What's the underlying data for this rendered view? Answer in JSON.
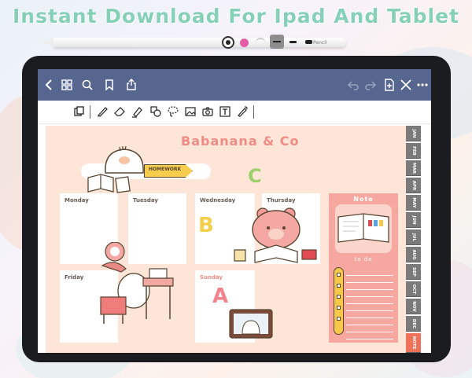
{
  "headline": "Instant Download For Ipad And Tablet",
  "pencil_brand": "Pencil",
  "planner": {
    "brand_title": "Babanana & Co",
    "homework_tag": "HOMEWORK",
    "days": {
      "monday": "Monday",
      "tuesday": "Tuesday",
      "wednesday": "Wednesday",
      "thursday": "Thursday",
      "friday": "Friday",
      "sunday": "Sunday"
    },
    "letters": {
      "c": "C",
      "b": "B",
      "a": "A"
    },
    "note_title": "Note",
    "todo_title": "to do"
  },
  "month_tabs": [
    "JAN",
    "FEB",
    "MAR",
    "APR",
    "MAY",
    "JUN",
    "JUL",
    "AUG",
    "SEP",
    "OCT",
    "NOV",
    "DEC",
    "NOTE"
  ],
  "colors": {
    "headline": "#86d0b8",
    "navbar": "#56668f",
    "page": "#fde6d8",
    "brand": "#f08b84",
    "note_panel": "#f6a79f",
    "tab": "#7a7a7a",
    "note_tab": "#f0715a",
    "letter_c": "#9dd06a",
    "letter_b": "#f4cf4c",
    "letter_a": "#f2838e"
  },
  "icons": {
    "navbar_left": [
      "back-icon",
      "grid-icon",
      "search-icon",
      "bookmark-icon",
      "share-icon"
    ],
    "navbar_right": [
      "undo-icon",
      "redo-icon",
      "add-page-icon",
      "close-icon",
      "more-icon"
    ],
    "toolbar": [
      "page-mode-icon",
      "pen-icon",
      "eraser-icon",
      "highlighter-icon",
      "shapes-icon",
      "lasso-icon",
      "image-icon",
      "camera-icon",
      "text-icon",
      "pointer-icon"
    ]
  }
}
